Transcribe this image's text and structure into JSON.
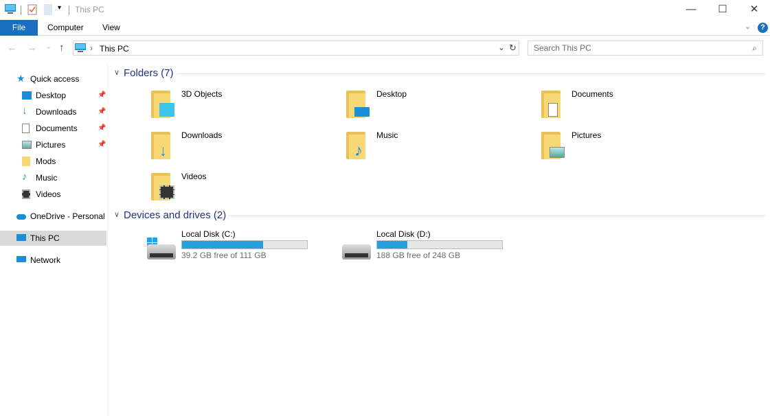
{
  "window": {
    "title": "This PC",
    "minimize": "—",
    "maximize": "☐",
    "close": "✕"
  },
  "ribbon": {
    "tabs": [
      {
        "label": "File"
      },
      {
        "label": "Computer"
      },
      {
        "label": "View"
      }
    ],
    "help": "?"
  },
  "nav": {
    "back": "←",
    "forward": "→",
    "recent": "⌄",
    "up": "↑",
    "path": "This PC",
    "separator": "›",
    "search_placeholder": "Search This PC"
  },
  "sidebar": {
    "items": [
      {
        "label": "Quick access",
        "icon": "star-icon",
        "pinned": false
      },
      {
        "label": "Desktop",
        "icon": "desktop-icon",
        "pinned": true
      },
      {
        "label": "Downloads",
        "icon": "download-icon",
        "pinned": true
      },
      {
        "label": "Documents",
        "icon": "document-icon",
        "pinned": true
      },
      {
        "label": "Pictures",
        "icon": "pictures-icon",
        "pinned": true
      },
      {
        "label": "Mods",
        "icon": "folder-icon",
        "pinned": false
      },
      {
        "label": "Music",
        "icon": "music-icon",
        "pinned": false
      },
      {
        "label": "Videos",
        "icon": "video-icon",
        "pinned": false
      },
      {
        "label": "OneDrive - Personal",
        "icon": "cloud-icon",
        "pinned": false
      },
      {
        "label": "This PC",
        "icon": "computer-icon",
        "pinned": false,
        "selected": true
      },
      {
        "label": "Network",
        "icon": "network-icon",
        "pinned": false
      }
    ]
  },
  "folders": {
    "header": "Folders (7)",
    "items": [
      {
        "label": "3D Objects",
        "icon": "3d-objects-icon"
      },
      {
        "label": "Desktop",
        "icon": "desktop-icon"
      },
      {
        "label": "Documents",
        "icon": "document-icon"
      },
      {
        "label": "Downloads",
        "icon": "download-icon"
      },
      {
        "label": "Music",
        "icon": "music-icon"
      },
      {
        "label": "Pictures",
        "icon": "pictures-icon"
      },
      {
        "label": "Videos",
        "icon": "video-icon"
      }
    ]
  },
  "drives": {
    "header": "Devices and drives (2)",
    "items": [
      {
        "label": "Local Disk (C:)",
        "free": "39.2 GB free of 111 GB",
        "used_percent": 64.7,
        "windows": true
      },
      {
        "label": "Local Disk (D:)",
        "free": "188 GB free of 248 GB",
        "used_percent": 24.2,
        "windows": false
      }
    ]
  },
  "colors": {
    "accent": "#1a6fc0",
    "bar_fill": "#26a0da",
    "group_header": "#1e3287"
  }
}
